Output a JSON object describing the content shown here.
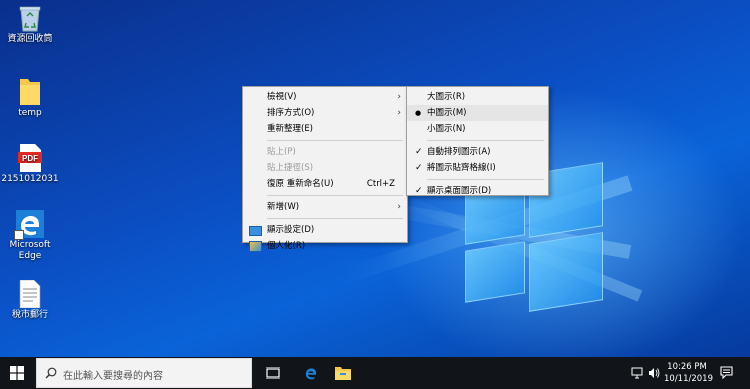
{
  "desktop_icons": [
    {
      "id": "recycle-bin",
      "label": "資源回收筒",
      "icon": "recycle-bin-icon"
    },
    {
      "id": "temp",
      "label": "temp",
      "icon": "folder-icon"
    },
    {
      "id": "pdf",
      "label": "2151012031",
      "icon": "pdf-file-icon",
      "badge": "PDF"
    },
    {
      "id": "edge",
      "label": "Microsoft Edge",
      "icon": "edge-icon"
    },
    {
      "id": "doc",
      "label": "稅市郵行",
      "icon": "document-icon"
    }
  ],
  "context_menu": {
    "items": [
      {
        "label": "檢視(V)",
        "submenu": true
      },
      {
        "label": "排序方式(O)",
        "submenu": true
      },
      {
        "label": "重新整理(E)"
      },
      {
        "separator": true
      },
      {
        "label": "貼上(P)",
        "disabled": true
      },
      {
        "label": "貼上捷徑(S)",
        "disabled": true
      },
      {
        "label": "復原 重新命名(U)",
        "shortcut": "Ctrl+Z"
      },
      {
        "separator": true
      },
      {
        "label": "新增(W)",
        "submenu": true
      },
      {
        "separator": true
      },
      {
        "label": "顯示設定(D)",
        "icon": "display-settings-icon"
      },
      {
        "label": "個人化(R)",
        "icon": "personalize-icon"
      }
    ]
  },
  "view_submenu": {
    "items": [
      {
        "label": "大圖示(R)"
      },
      {
        "label": "中圖示(M)",
        "mark": "●",
        "highlighted": true
      },
      {
        "label": "小圖示(N)"
      },
      {
        "separator": true
      },
      {
        "label": "自動排列圖示(A)",
        "mark": "✓"
      },
      {
        "label": "將圖示貼齊格線(I)",
        "mark": "✓"
      },
      {
        "separator": true
      },
      {
        "label": "顯示桌面圖示(D)",
        "mark": "✓"
      }
    ]
  },
  "taskbar": {
    "search_placeholder": "在此輸入要搜尋的內容",
    "time": "10:26 PM",
    "date": "10/11/2019",
    "colors": {
      "taskbar": "#111418",
      "edge": "#1e7fd8",
      "folder": "#f5c84c"
    }
  }
}
